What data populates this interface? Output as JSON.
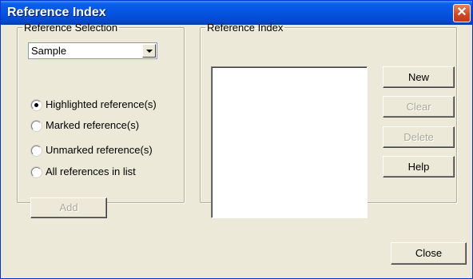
{
  "window": {
    "title": "Reference Index",
    "close_glyph": "✕"
  },
  "reference_selection": {
    "legend": "Reference Selection",
    "dropdown_value": "Sample",
    "options": [
      {
        "label": "Highlighted reference(s)",
        "checked": true
      },
      {
        "label": "Marked reference(s)",
        "checked": false
      },
      {
        "label": "Unmarked reference(s)",
        "checked": false
      },
      {
        "label": "All references in list",
        "checked": false
      }
    ],
    "add_label": "Add"
  },
  "reference_index": {
    "legend": "Reference Index",
    "new_label": "New",
    "clear_label": "Clear",
    "delete_label": "Delete",
    "help_label": "Help"
  },
  "close_label": "Close",
  "colors": {
    "titlebar": "#0554E2",
    "background": "#ECE9D8",
    "disabled_text": "#ACA899"
  }
}
